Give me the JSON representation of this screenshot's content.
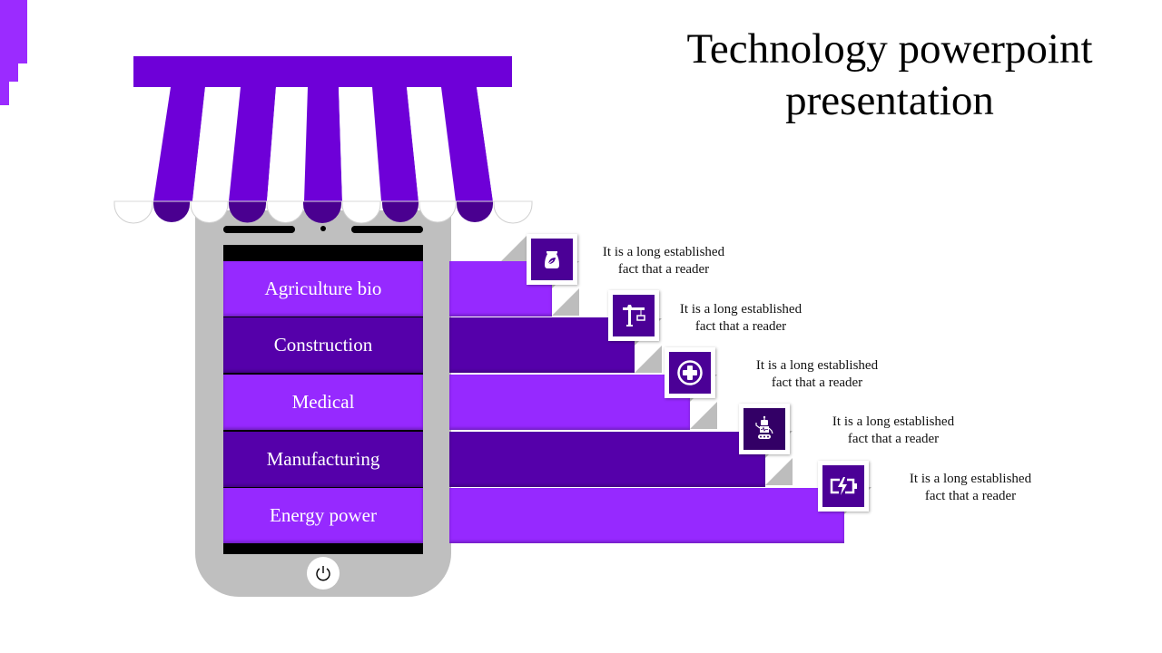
{
  "slide": {
    "title_line1": "Technology powerpoint",
    "title_line2": "presentation"
  },
  "colors": {
    "accent_light": "#9629ff",
    "accent_dark": "#5500aa",
    "awning_purple": "#6e00d8",
    "awning_shadow": "#4a0090",
    "icon_bg": "#4b0096",
    "phone_gray": "#bfbfbf"
  },
  "menu": {
    "items": [
      {
        "label": "Agriculture bio",
        "icon": "seed-bag-leaf-icon",
        "description_line1": "It is a long established",
        "description_line2": "fact that a reader"
      },
      {
        "label": "Construction",
        "icon": "crane-icon",
        "description_line1": "It is a long established",
        "description_line2": "fact that a reader"
      },
      {
        "label": "Medical",
        "icon": "medical-cross-icon",
        "description_line1": "It is a long established",
        "description_line2": "fact that a reader"
      },
      {
        "label": "Manufacturing",
        "icon": "robot-icon",
        "description_line1": "It is a long established",
        "description_line2": "fact that a reader"
      },
      {
        "label": "Energy power",
        "icon": "battery-charging-icon",
        "description_line1": "It is a long established",
        "description_line2": "fact that a reader"
      }
    ]
  },
  "phone": {
    "button_icon": "power-icon"
  }
}
